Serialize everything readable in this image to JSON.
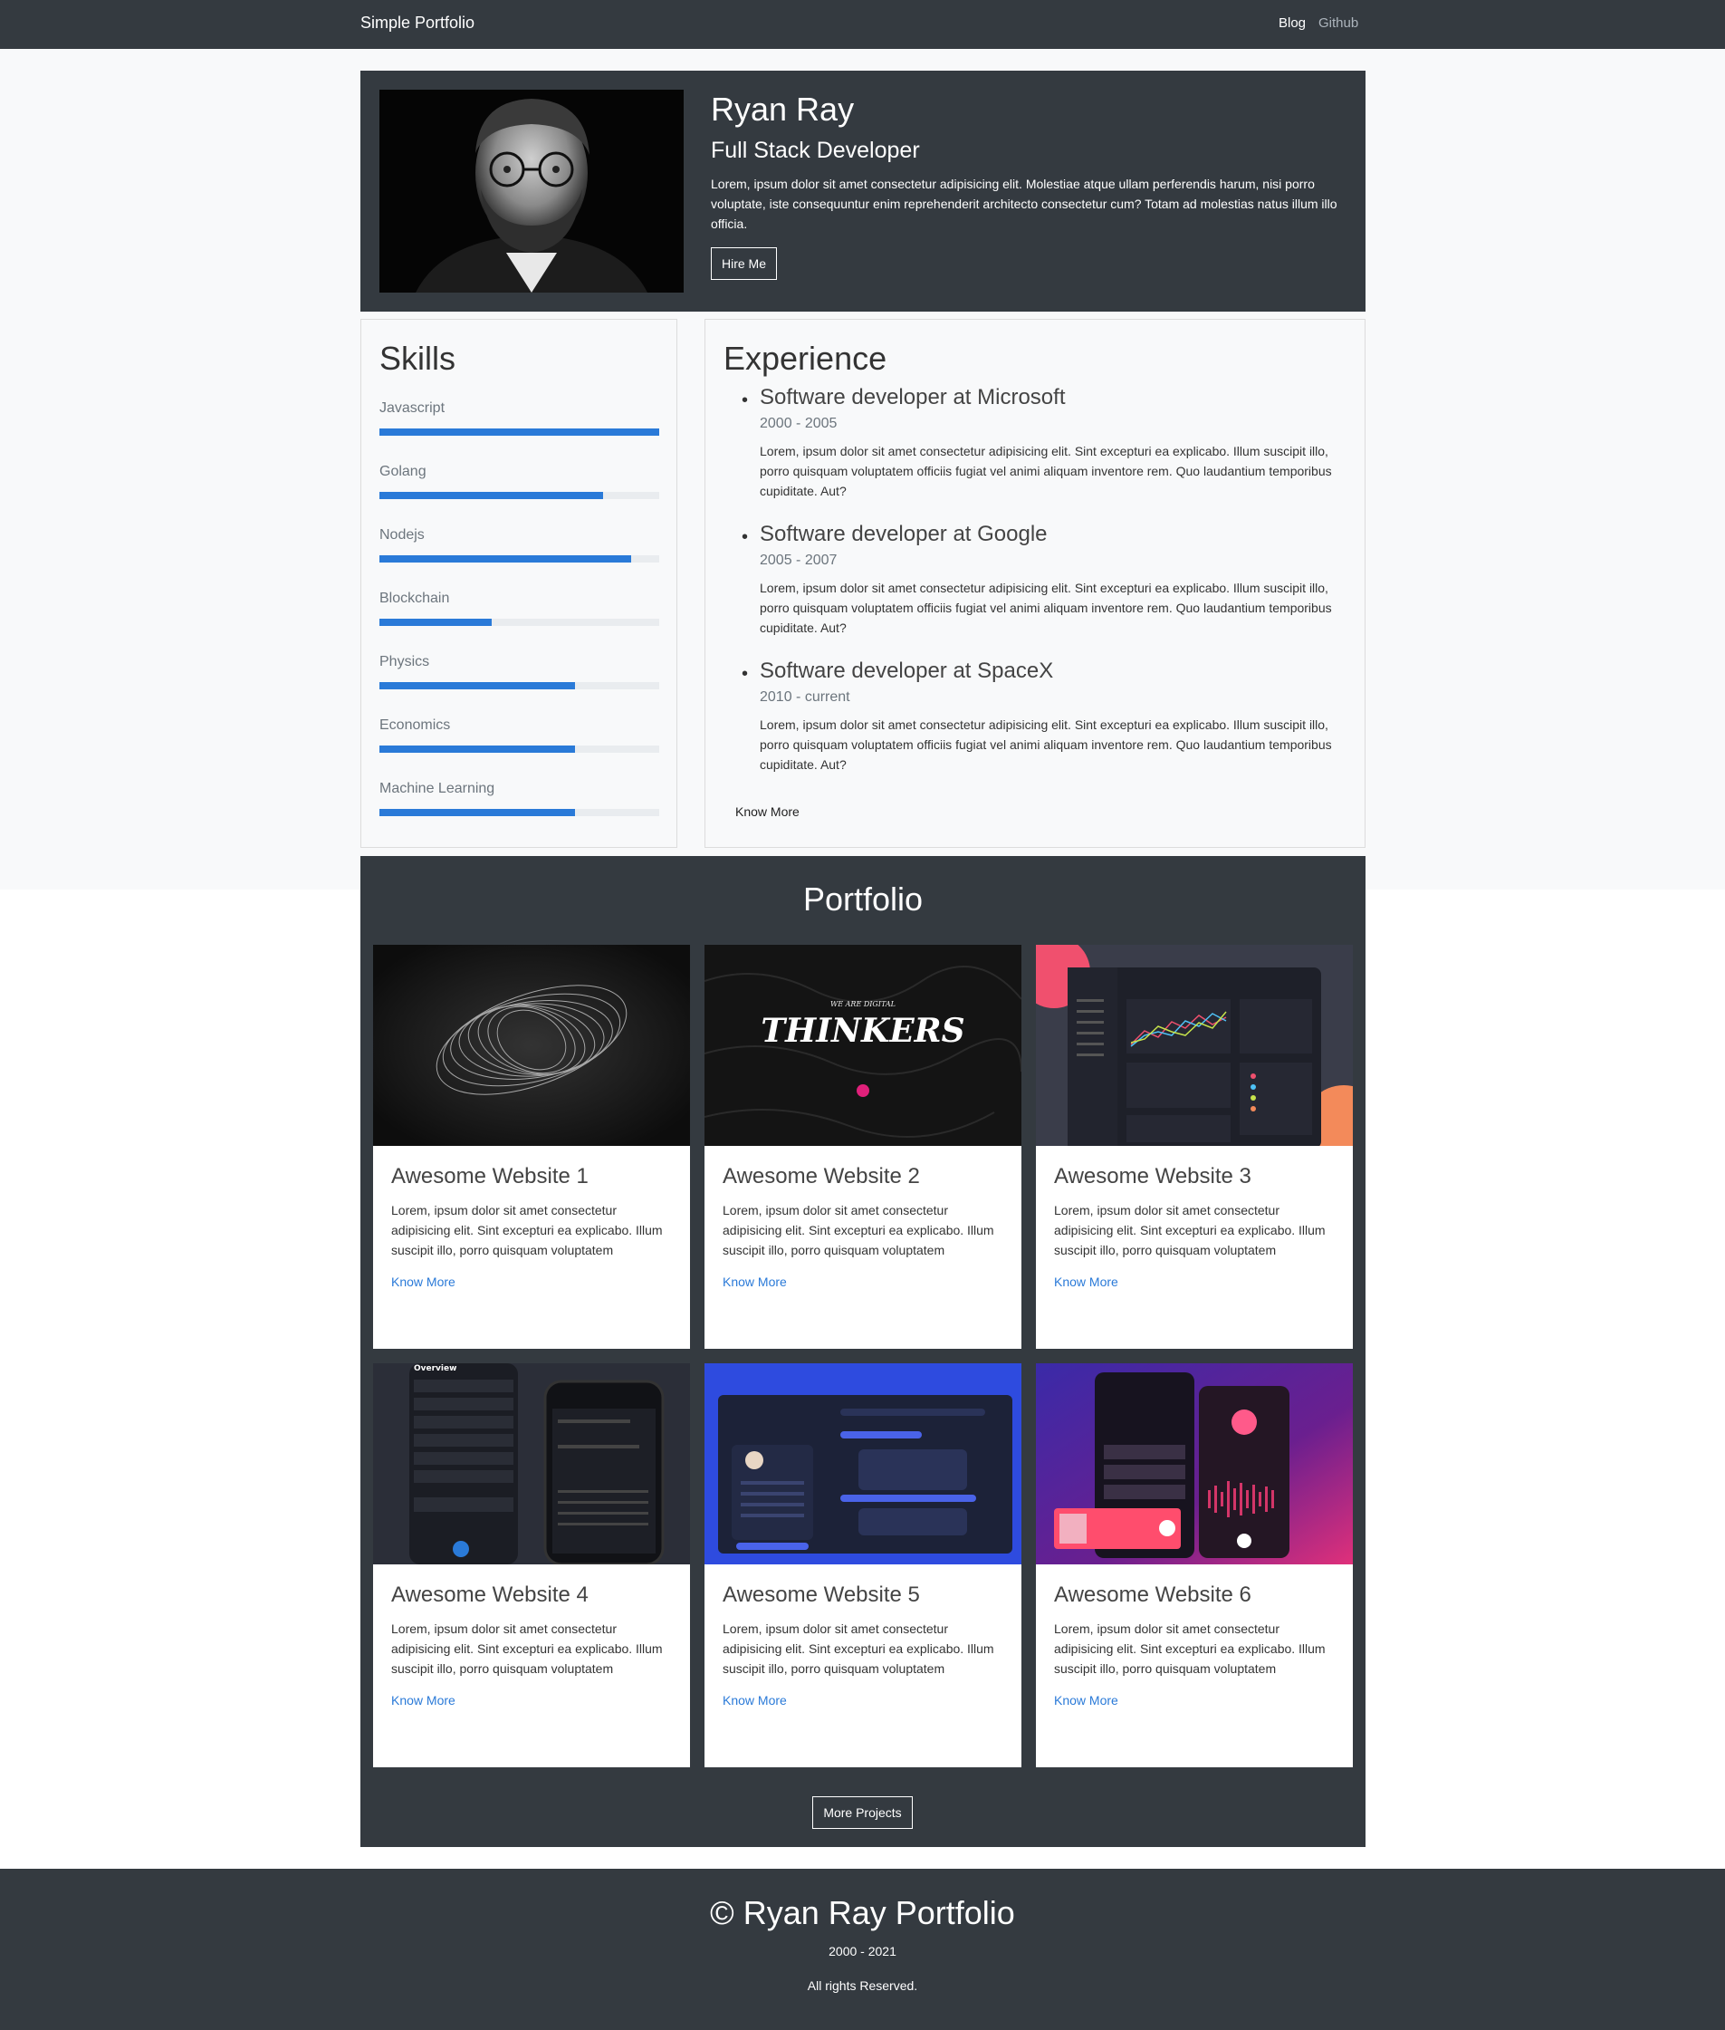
{
  "navbar": {
    "brand": "Simple Portfolio",
    "links": [
      "Blog",
      "Github"
    ]
  },
  "hero": {
    "name": "Ryan Ray",
    "role": "Full Stack Developer",
    "bio": "Lorem, ipsum dolor sit amet consectetur adipisicing elit. Molestiae atque ullam perferendis harum, nisi porro voluptate, iste consequuntur enim reprehenderit architecto consectetur cum? Totam ad molestias natus illum illo officia.",
    "hire_label": "Hire Me"
  },
  "skills": {
    "title": "Skills",
    "items": [
      {
        "label": "Javascript",
        "level": 100
      },
      {
        "label": "Golang",
        "level": 80
      },
      {
        "label": "Nodejs",
        "level": 90
      },
      {
        "label": "Blockchain",
        "level": 40
      },
      {
        "label": "Physics",
        "level": 70
      },
      {
        "label": "Economics",
        "level": 70
      },
      {
        "label": "Machine Learning",
        "level": 70
      }
    ],
    "bar_color": "#2a7ad8"
  },
  "experience": {
    "title": "Experience",
    "jobs": [
      {
        "title": "Software developer at Microsoft",
        "dates": "2000 - 2005",
        "desc": "Lorem, ipsum dolor sit amet consectetur adipisicing elit. Sint excepturi ea explicabo. Illum suscipit illo, porro quisquam voluptatem officiis fugiat vel animi aliquam inventore rem. Quo laudantium temporibus cupiditate. Aut?"
      },
      {
        "title": "Software developer at Google",
        "dates": "2005 - 2007",
        "desc": "Lorem, ipsum dolor sit amet consectetur adipisicing elit. Sint excepturi ea explicabo. Illum suscipit illo, porro quisquam voluptatem officiis fugiat vel animi aliquam inventore rem. Quo laudantium temporibus cupiditate. Aut?"
      },
      {
        "title": "Software developer at SpaceX",
        "dates": "2010 - current",
        "desc": "Lorem, ipsum dolor sit amet consectetur adipisicing elit. Sint excepturi ea explicabo. Illum suscipit illo, porro quisquam voluptatem officiis fugiat vel animi aliquam inventore rem. Quo laudantium temporibus cupiditate. Aut?"
      }
    ],
    "know_more": "Know More"
  },
  "portfolio": {
    "title": "Portfolio",
    "cards": [
      {
        "title": "Awesome Website 1",
        "desc": "Lorem, ipsum dolor sit amet consectetur adipisicing elit. Sint excepturi ea explicabo. Illum suscipit illo, porro quisquam voluptatem",
        "link": "Know More"
      },
      {
        "title": "Awesome Website 2",
        "desc": "Lorem, ipsum dolor sit amet consectetur adipisicing elit. Sint excepturi ea explicabo. Illum suscipit illo, porro quisquam voluptatem",
        "link": "Know More",
        "thumb_text": "THINKERS",
        "thumb_small": "WE ARE DIGITAL"
      },
      {
        "title": "Awesome Website 3",
        "desc": "Lorem, ipsum dolor sit amet consectetur adipisicing elit. Sint excepturi ea explicabo. Illum suscipit illo, porro quisquam voluptatem",
        "link": "Know More"
      },
      {
        "title": "Awesome Website 4",
        "desc": "Lorem, ipsum dolor sit amet consectetur adipisicing elit. Sint excepturi ea explicabo. Illum suscipit illo, porro quisquam voluptatem",
        "link": "Know More",
        "thumb_text": "Overview"
      },
      {
        "title": "Awesome Website 5",
        "desc": "Lorem, ipsum dolor sit amet consectetur adipisicing elit. Sint excepturi ea explicabo. Illum suscipit illo, porro quisquam voluptatem",
        "link": "Know More"
      },
      {
        "title": "Awesome Website 6",
        "desc": "Lorem, ipsum dolor sit amet consectetur adipisicing elit. Sint excepturi ea explicabo. Illum suscipit illo, porro quisquam voluptatem",
        "link": "Know More"
      }
    ],
    "more_label": "More Projects"
  },
  "footer": {
    "copyright": "© Ryan Ray Portfolio",
    "years": "2000 - 2021",
    "rights": "All rights Reserved."
  },
  "colors": {
    "dark": "#343a40",
    "light_bg": "#f8f9fa",
    "accent": "#2a7ad8",
    "link": "#2a7ad8"
  }
}
